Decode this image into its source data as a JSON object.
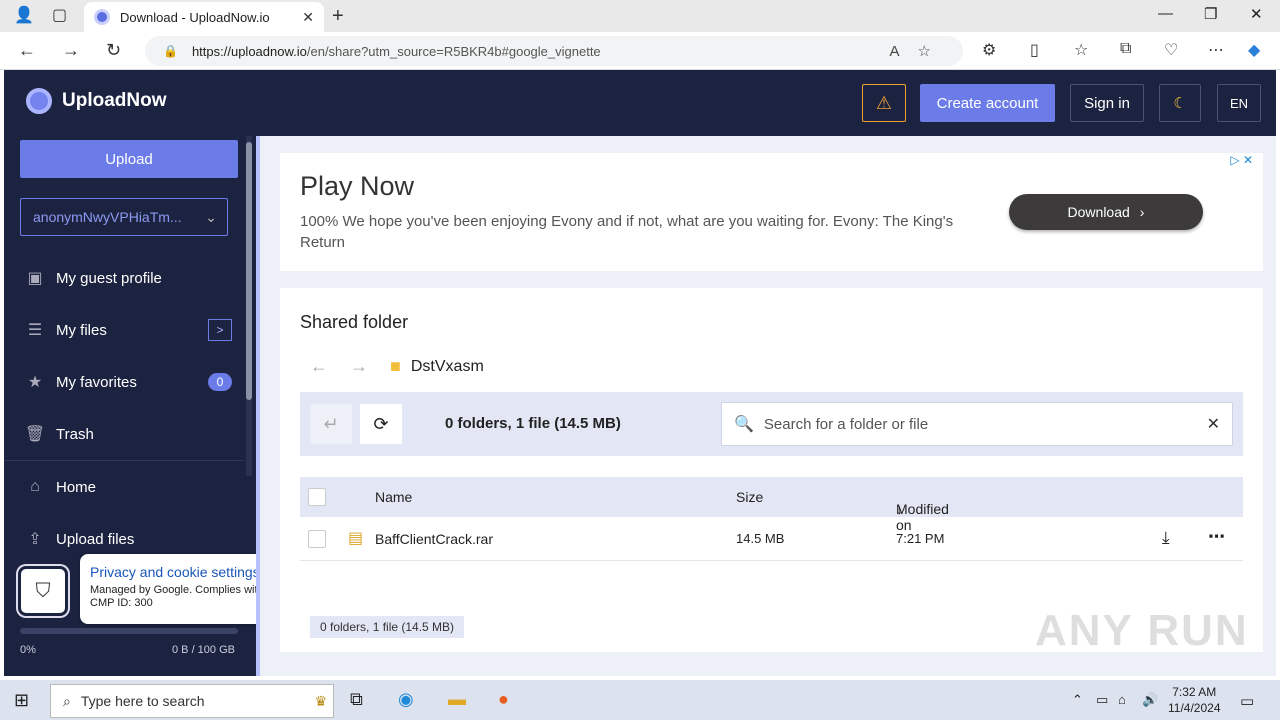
{
  "browser": {
    "tab_title": "Download - UploadNow.io",
    "url_domain": "https://uploadnow.io",
    "url_path": "/en/share?utm_source=R5BKR4b#google_vignette"
  },
  "header": {
    "brand": "UploadNow",
    "create_account": "Create account",
    "sign_in": "Sign in",
    "lang": "EN"
  },
  "sidebar": {
    "upload": "Upload",
    "account": "anonymNwyVPHiaTm...",
    "items": [
      {
        "label": "My guest profile"
      },
      {
        "label": "My files"
      },
      {
        "label": "My favorites",
        "badge": "0"
      },
      {
        "label": "Trash"
      },
      {
        "label": "Home"
      },
      {
        "label": "Upload files"
      }
    ],
    "storage_percent": "0%",
    "storage_used": "0 B / 100 GB"
  },
  "privacy": {
    "title": "Privacy and cookie settings",
    "line1": "Managed by Google. Complies with IAB TCF.",
    "line2": "CMP ID: 300"
  },
  "ad": {
    "headline": "Play Now",
    "desc": "100% We hope you've been enjoying Evony and if not, what are you waiting for. Evony: The King's Return",
    "cta": "Download"
  },
  "folder": {
    "title": "Shared folder",
    "name": "DstVxasm",
    "summary": "0 folders, 1 file (14.5 MB)",
    "search_placeholder": "Search for a folder or file",
    "columns": {
      "name": "Name",
      "size": "Size",
      "modified": "Modified on"
    },
    "files": [
      {
        "name": "BaffClientCrack.rar",
        "size": "14.5 MB",
        "modified": "7:21 PM"
      }
    ],
    "footer": "0 folders, 1 file (14.5 MB)"
  },
  "taskbar": {
    "search": "Type here to search",
    "time": "7:32 AM",
    "date": "11/4/2024"
  },
  "watermark": "ANY RUN"
}
